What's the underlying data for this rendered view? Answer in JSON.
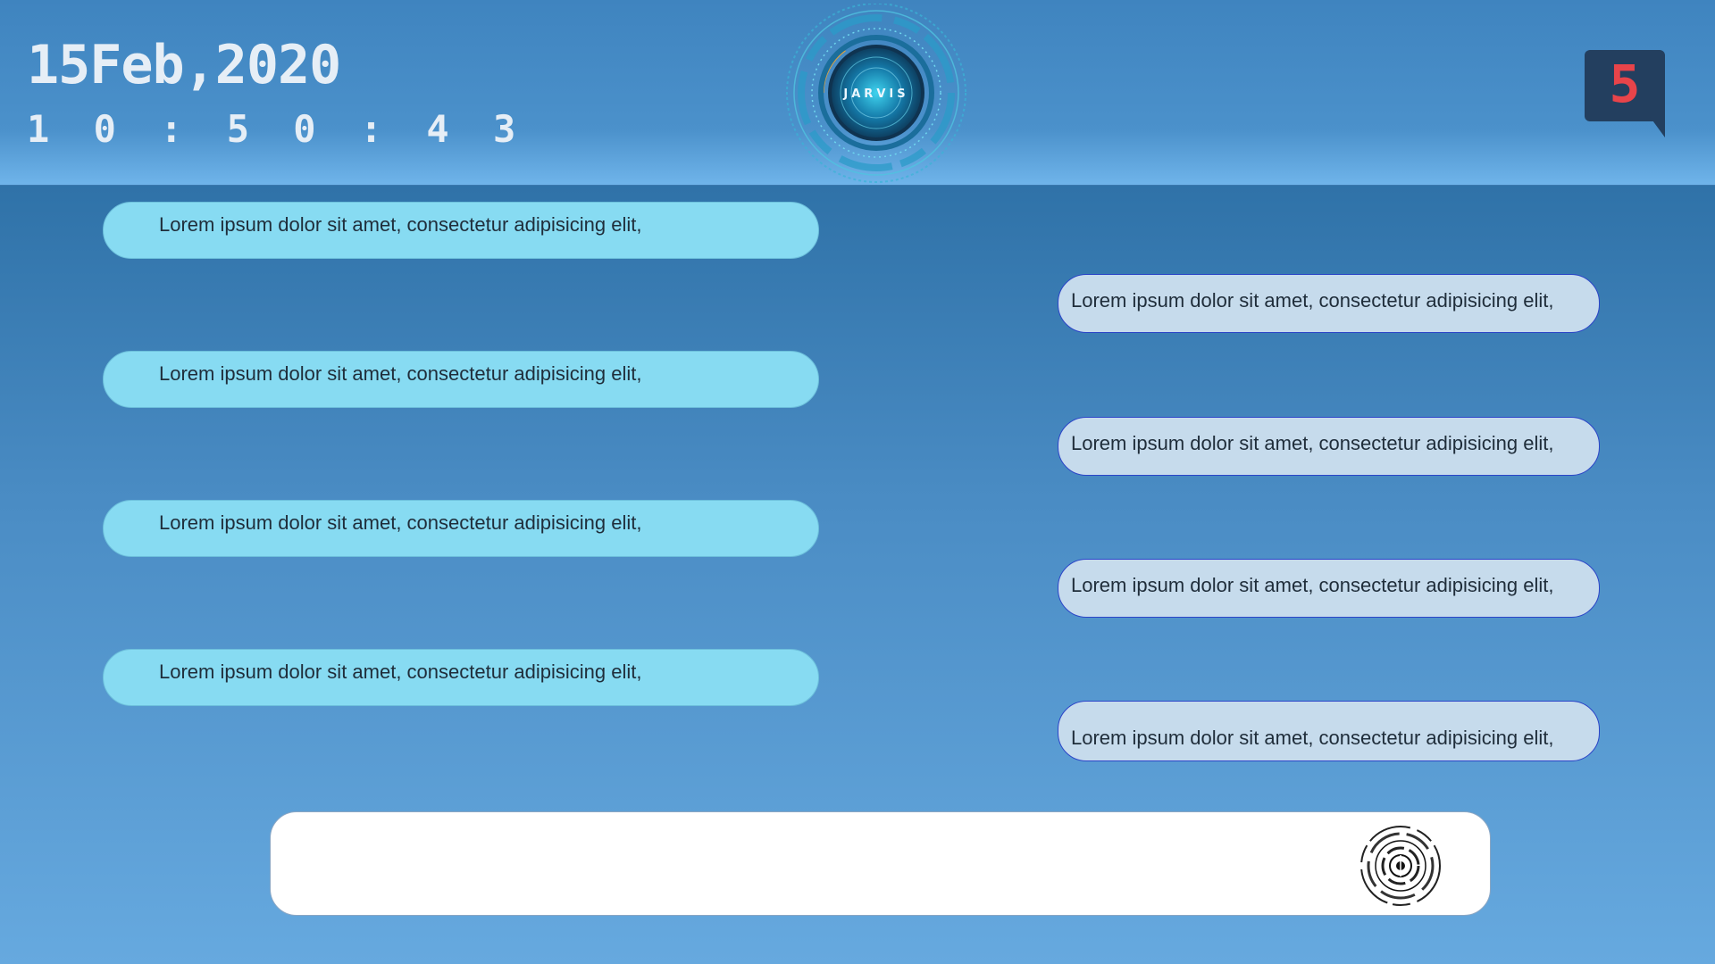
{
  "header": {
    "date": "15Feb,2020",
    "time": "1 0 : 5 0 : 4 3",
    "logo_text": "JARVIS",
    "notification_count": "5",
    "colors": {
      "badge_bg": "#233f5f",
      "badge_number": "#e8444a"
    }
  },
  "messages": [
    {
      "side": "left",
      "text": "Lorem ipsum dolor sit amet, consectetur adipisicing elit,"
    },
    {
      "side": "right",
      "text": "Lorem ipsum dolor sit amet, consectetur adipisicing elit,"
    },
    {
      "side": "left",
      "text": "Lorem ipsum dolor sit amet, consectetur adipisicing elit,"
    },
    {
      "side": "right",
      "text": "Lorem ipsum dolor sit amet, consectetur adipisicing elit,"
    },
    {
      "side": "left",
      "text": "Lorem ipsum dolor sit amet, consectetur adipisicing elit,"
    },
    {
      "side": "right",
      "text": "Lorem ipsum dolor sit amet, consectetur adipisicing elit,"
    },
    {
      "side": "left",
      "text": "Lorem ipsum dolor sit amet, consectetur adipisicing elit,"
    },
    {
      "side": "right",
      "text": "Lorem ipsum dolor sit amet, consectetur adipisicing elit,"
    }
  ],
  "input": {
    "value": "",
    "mic_icon": "mic-icon"
  },
  "colors": {
    "left_bubble": "#87dbf2",
    "right_bubble": "#c6dbec",
    "right_bubble_border": "#2c45c8"
  }
}
